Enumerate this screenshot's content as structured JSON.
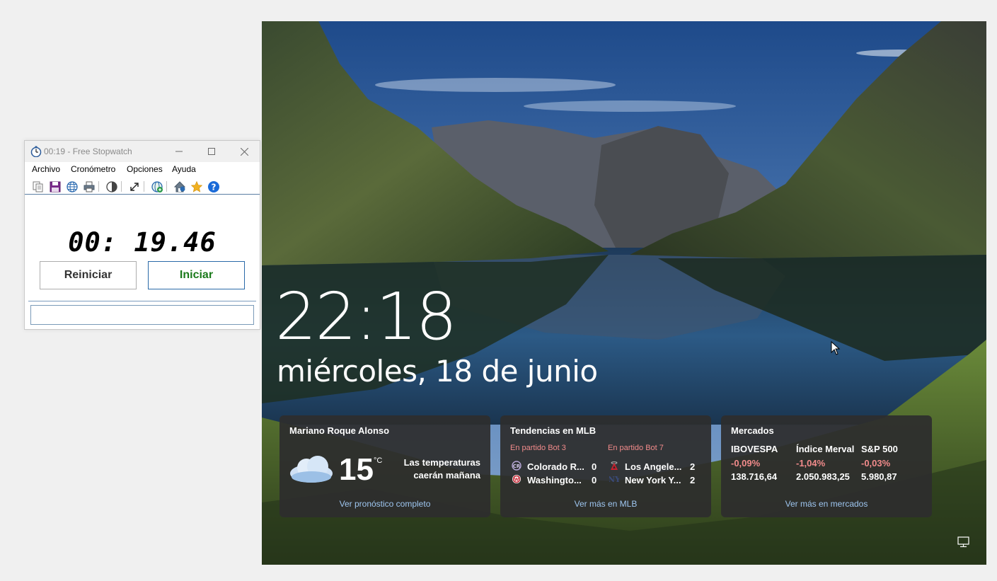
{
  "stopwatch": {
    "title": "00:19 - Free Stopwatch",
    "menu": [
      "Archivo",
      "Cronómetro",
      "Opciones",
      "Ayuda"
    ],
    "time_display": "00: 19.46",
    "reset_label": "Reiniciar",
    "start_label": "Iniciar",
    "note_value": "",
    "toolbar_icons": [
      "copy-icon",
      "save-icon",
      "globe-icon",
      "print-icon",
      "contrast-icon",
      "fullscreen-icon",
      "web-clock-icon",
      "home-icon",
      "star-icon",
      "help-icon"
    ],
    "start_color": "#1a7a1a"
  },
  "lockscreen": {
    "time": "22:18",
    "date": "miércoles, 18 de junio",
    "weather": {
      "location": "Mariano Roque Alonso",
      "temperature": "15",
      "unit": "°C",
      "description": "Las temperaturas caerán mañana",
      "link": "Ver pronóstico completo",
      "icon": "cloud-icon"
    },
    "mlb": {
      "title": "Tendencias en MLB",
      "games": [
        {
          "status": "En partido Bot 3",
          "teams": [
            {
              "name": "Colorado R...",
              "score": "0",
              "logo": "rockies-logo-icon"
            },
            {
              "name": "Washingto...",
              "score": "0",
              "logo": "nationals-logo-icon"
            }
          ]
        },
        {
          "status": "En partido Bot 7",
          "teams": [
            {
              "name": "Los Angele...",
              "score": "2",
              "logo": "angels-logo-icon"
            },
            {
              "name": "New York Y...",
              "score": "2",
              "logo": "yankees-logo-icon"
            }
          ]
        }
      ],
      "link": "Ver más en MLB"
    },
    "markets": {
      "title": "Mercados",
      "items": [
        {
          "name": "IBOVESPA",
          "change": "-0,09%",
          "value": "138.716,64"
        },
        {
          "name": "Índice Merval",
          "change": "-1,04%",
          "value": "2.050.983,25"
        },
        {
          "name": "S&P 500",
          "change": "-0,03%",
          "value": "5.980,87"
        }
      ],
      "link": "Ver más en mercados"
    },
    "colors": {
      "negative": "#f28b8b",
      "link": "#9ec6f0",
      "card_bg": "#2d2d2d"
    }
  }
}
